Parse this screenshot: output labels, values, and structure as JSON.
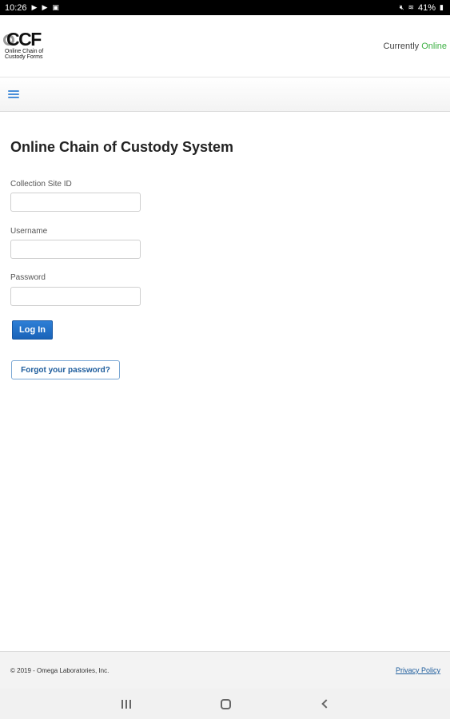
{
  "status_bar": {
    "time": "10:26",
    "battery": "41%"
  },
  "header": {
    "logo_text": "CCF",
    "logo_subtitle_line1": "Online Chain of",
    "logo_subtitle_line2": "Custody Forms",
    "status_prefix": "Currently",
    "status_value": "Online",
    "status_color": "#3cb043"
  },
  "nav": {
    "menu_icon": "hamburger-menu-icon"
  },
  "main": {
    "title": "Online Chain of Custody System",
    "fields": [
      {
        "label": "Collection Site ID",
        "value": "",
        "placeholder": ""
      },
      {
        "label": "Username",
        "value": "",
        "placeholder": ""
      },
      {
        "label": "Password",
        "value": "",
        "placeholder": ""
      }
    ],
    "login_label": "Log In",
    "forgot_label": "Forgot your password?",
    "accent_color": "#1a63b8"
  },
  "footer": {
    "copyright": "© 2019 - Omega Laboratories, Inc.",
    "privacy_label": "Privacy Policy"
  }
}
